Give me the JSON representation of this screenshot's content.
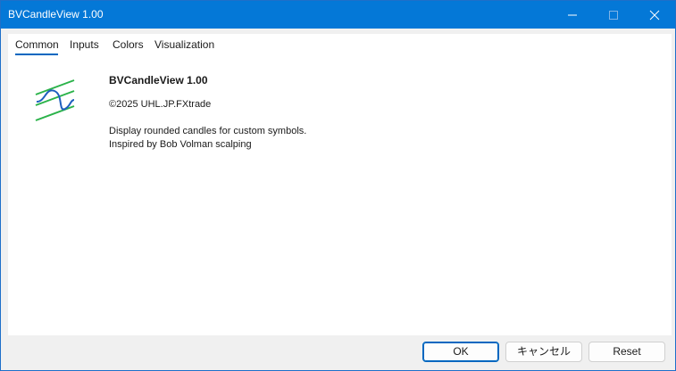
{
  "window": {
    "title": "BVCandleView 1.00",
    "titlebar_color": "#0478d7"
  },
  "controls": {
    "minimize_icon": "minimize-icon",
    "maximize_icon": "maximize-icon",
    "close_icon": "close-icon"
  },
  "tabs": [
    {
      "label": "Common",
      "active": true
    },
    {
      "label": "Inputs",
      "active": false
    },
    {
      "label": "Colors",
      "active": false
    },
    {
      "label": "Visualization",
      "active": false
    }
  ],
  "info": {
    "logo_icon": "indicator-sine-wave-icon",
    "title": "BVCandleView 1.00",
    "copyright": "©2025 UHL.JP.FXtrade",
    "description_line1": "Display rounded candles for custom symbols.",
    "description_line2": "Inspired by Bob Volman scalping"
  },
  "buttons": {
    "ok": "OK",
    "cancel": "キャンセル",
    "reset": "Reset"
  },
  "colors": {
    "accent": "#0067c0",
    "logo_green": "#2bb34a",
    "logo_blue": "#1f5fbf"
  }
}
